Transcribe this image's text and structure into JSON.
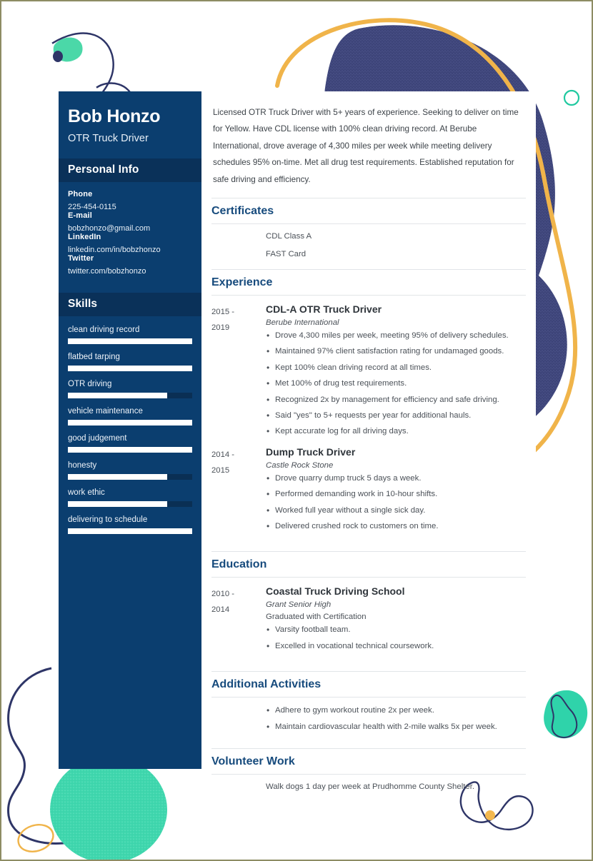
{
  "colors": {
    "sidebar_bg": "#0b3e6f",
    "sidebar_heading_bg": "#0a3159",
    "section_title": "#174b7d",
    "accent_navy": "#2e3567",
    "accent_teal": "#3fd6ad",
    "accent_orange": "#f0b44a",
    "page_border": "#8d8c63",
    "body_text": "#4b5158"
  },
  "sidebar": {
    "name": "Bob Honzo",
    "role": "OTR Truck Driver",
    "personal_info_heading": "Personal Info",
    "contacts": [
      {
        "label": "Phone",
        "value": "225-454-0115"
      },
      {
        "label": "E-mail",
        "value": "bobzhonzo@gmail.com"
      },
      {
        "label": "LinkedIn",
        "value": "linkedin.com/in/bobzhonzo"
      },
      {
        "label": "Twitter",
        "value": "twitter.com/bobzhonzo"
      }
    ],
    "skills_heading": "Skills",
    "skills": [
      {
        "name": "clean driving record",
        "level": 100
      },
      {
        "name": "flatbed tarping",
        "level": 100
      },
      {
        "name": "OTR driving",
        "level": 80
      },
      {
        "name": "vehicle maintenance",
        "level": 100
      },
      {
        "name": "good judgement",
        "level": 100
      },
      {
        "name": "honesty",
        "level": 80
      },
      {
        "name": "work ethic",
        "level": 80
      },
      {
        "name": "delivering to schedule",
        "level": 100
      }
    ]
  },
  "main": {
    "summary": "Licensed OTR Truck Driver with 5+ years of experience. Seeking to deliver on time for Yellow. Have CDL license with 100% clean driving record. At Berube International, drove average of 4,300 miles per week while meeting delivery schedules 95% on-time. Met all drug test requirements. Established reputation for safe driving and efficiency.",
    "sections": {
      "certificates": {
        "title": "Certificates",
        "items": [
          "CDL Class A",
          "FAST Card"
        ]
      },
      "experience": {
        "title": "Experience",
        "entries": [
          {
            "dates_from": "2015 -",
            "dates_to": "2019",
            "title": "CDL-A OTR Truck Driver",
            "company": "Berube International",
            "bullets": [
              "Drove 4,300 miles per week, meeting 95% of delivery schedules.",
              "Maintained 97% client satisfaction rating for undamaged goods.",
              "Kept 100% clean driving record at all times.",
              "Met 100% of drug test requirements.",
              "Recognized 2x by management for efficiency and safe driving.",
              "Said \"yes\" to 5+ requests per year for additional hauls.",
              "Kept accurate log for all driving days."
            ]
          },
          {
            "dates_from": "2014 -",
            "dates_to": "2015",
            "title": "Dump Truck Driver",
            "company": "Castle Rock Stone",
            "bullets": [
              "Drove quarry dump truck 5 days a week.",
              "Performed demanding work in 10-hour shifts.",
              "Worked full year without a single sick day.",
              "Delivered crushed rock to customers on time."
            ]
          }
        ]
      },
      "education": {
        "title": "Education",
        "entries": [
          {
            "dates_from": "2010 -",
            "dates_to": "2014",
            "title": "Coastal Truck Driving School",
            "school": "Grant Senior High",
            "note": "Graduated with Certification",
            "bullets": [
              "Varsity football team.",
              "Excelled in vocational technical coursework."
            ]
          }
        ]
      },
      "additional_activities": {
        "title": "Additional Activities",
        "bullets": [
          "Adhere to gym workout routine 2x per week.",
          "Maintain cardiovascular health with 2-mile walks 5x per week."
        ]
      },
      "volunteer_work": {
        "title": "Volunteer Work",
        "items": [
          "Walk dogs 1 day per week at Prudhomme County Shelter."
        ]
      }
    }
  }
}
